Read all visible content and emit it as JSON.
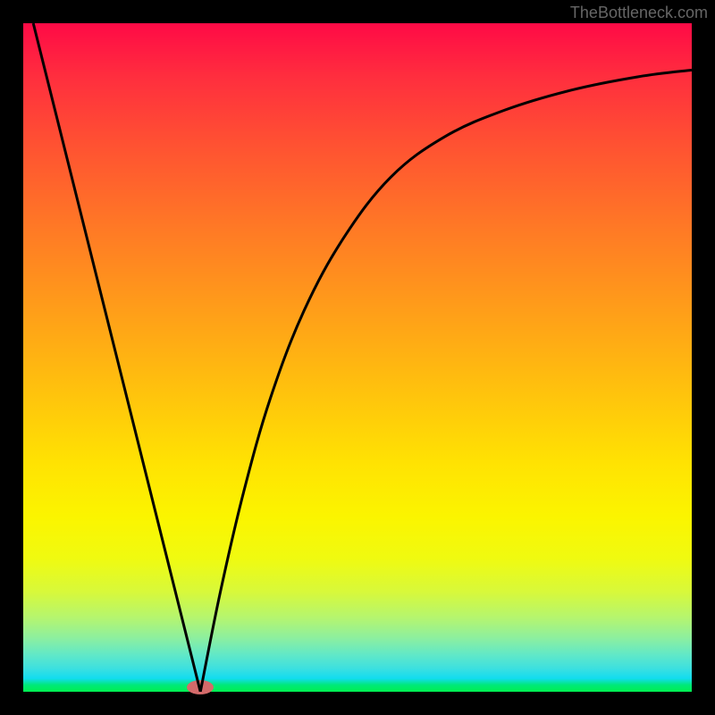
{
  "watermark": "TheBottleneck.com",
  "chart_data": {
    "type": "line",
    "title": "",
    "xlabel": "",
    "ylabel": "",
    "xlim": [
      0,
      1
    ],
    "ylim": [
      0,
      1
    ],
    "series": [
      {
        "name": "left-branch",
        "x": [
          0.015,
          0.065,
          0.115,
          0.165,
          0.215,
          0.265
        ],
        "y": [
          1.0,
          0.8,
          0.6,
          0.4,
          0.2,
          0.0
        ]
      },
      {
        "name": "right-branch",
        "x": [
          0.265,
          0.295,
          0.33,
          0.37,
          0.42,
          0.48,
          0.55,
          0.63,
          0.72,
          0.82,
          0.92,
          1.0
        ],
        "y": [
          0.0,
          0.15,
          0.3,
          0.44,
          0.57,
          0.68,
          0.77,
          0.83,
          0.87,
          0.9,
          0.92,
          0.93
        ]
      }
    ],
    "marker": {
      "x": 0.265,
      "y": 0.0
    },
    "gradient_colors": {
      "top": "#ff0a46",
      "mid_orange": "#ff9b1a",
      "mid_yellow": "#fbf500",
      "bottom": "#00f050"
    }
  }
}
